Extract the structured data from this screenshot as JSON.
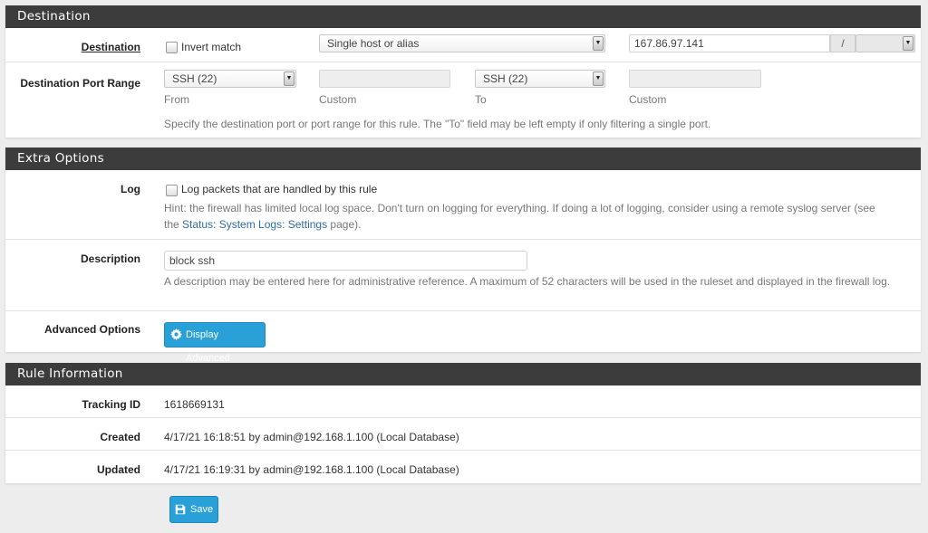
{
  "destination": {
    "heading": "Destination",
    "label": "Destination",
    "invert_label": "Invert match",
    "type_select": "Single host or alias",
    "address_value": "167.86.97.141",
    "mask_sep": "/",
    "port_range": {
      "label": "Destination Port Range",
      "from_select": "SSH (22)",
      "from_caption": "From",
      "custom_caption_1": "Custom",
      "to_select": "SSH (22)",
      "to_caption": "To",
      "custom_caption_2": "Custom",
      "help": "Specify the destination port or port range for this rule. The \"To\" field may be left empty if only filtering a single port."
    }
  },
  "extra": {
    "heading": "Extra Options",
    "log_label": "Log",
    "log_checkbox_label": "Log packets that are handled by this rule",
    "log_hint_1": "Hint: the firewall has limited local log space. Don't turn on logging for everything. If doing a lot of logging, consider using a remote syslog server (see",
    "log_hint_2a": "the ",
    "log_hint_link": "Status: System Logs: Settings",
    "log_hint_2b": " page).",
    "desc_label": "Description",
    "desc_value": "block ssh",
    "desc_help": "A description may be entered here for administrative reference. A maximum of 52 characters will be used in the ruleset and displayed in the firewall log.",
    "adv_label": "Advanced Options",
    "adv_button": "Display Advanced"
  },
  "rule_info": {
    "heading": "Rule Information",
    "tracking_label": "Tracking ID",
    "tracking_value": "1618669131",
    "created_label": "Created",
    "created_value": "4/17/21 16:18:51 by admin@192.168.1.100 (Local Database)",
    "updated_label": "Updated",
    "updated_value": "4/17/21 16:19:31 by admin@192.168.1.100 (Local Database)"
  },
  "save_button": "Save",
  "icons": {
    "gear": "gear-icon",
    "save": "floppy-disk-icon",
    "dropdown": "triangle-down"
  },
  "colors": {
    "heading_bg": "#3c3c3c",
    "button_blue": "#29a0d8",
    "link": "#2d6ca2"
  }
}
